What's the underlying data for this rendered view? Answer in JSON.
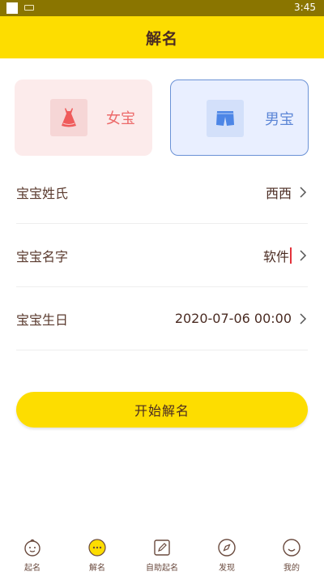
{
  "status_bar": {
    "time": "3:45"
  },
  "header": {
    "title": "解名"
  },
  "gender": {
    "girl_label": "女宝",
    "boy_label": "男宝",
    "selected": "男宝"
  },
  "form": {
    "surname": {
      "label": "宝宝姓氏",
      "value": "西西"
    },
    "name": {
      "label": "宝宝名字",
      "value": "软件"
    },
    "birthday": {
      "label": "宝宝生日",
      "value": "2020-07-06 00:00"
    }
  },
  "start_button": {
    "label": "开始解名"
  },
  "tabs": [
    {
      "label": "起名",
      "icon": "baby-face-icon"
    },
    {
      "label": "解名",
      "icon": "chat-bubble-icon",
      "active": true
    },
    {
      "label": "自助起名",
      "icon": "edit-icon"
    },
    {
      "label": "发现",
      "icon": "compass-icon"
    },
    {
      "label": "我的",
      "icon": "smile-icon"
    }
  ],
  "colors": {
    "accent": "#fddd00",
    "girl": "#ec6a6a",
    "boy": "#5c86d6"
  }
}
